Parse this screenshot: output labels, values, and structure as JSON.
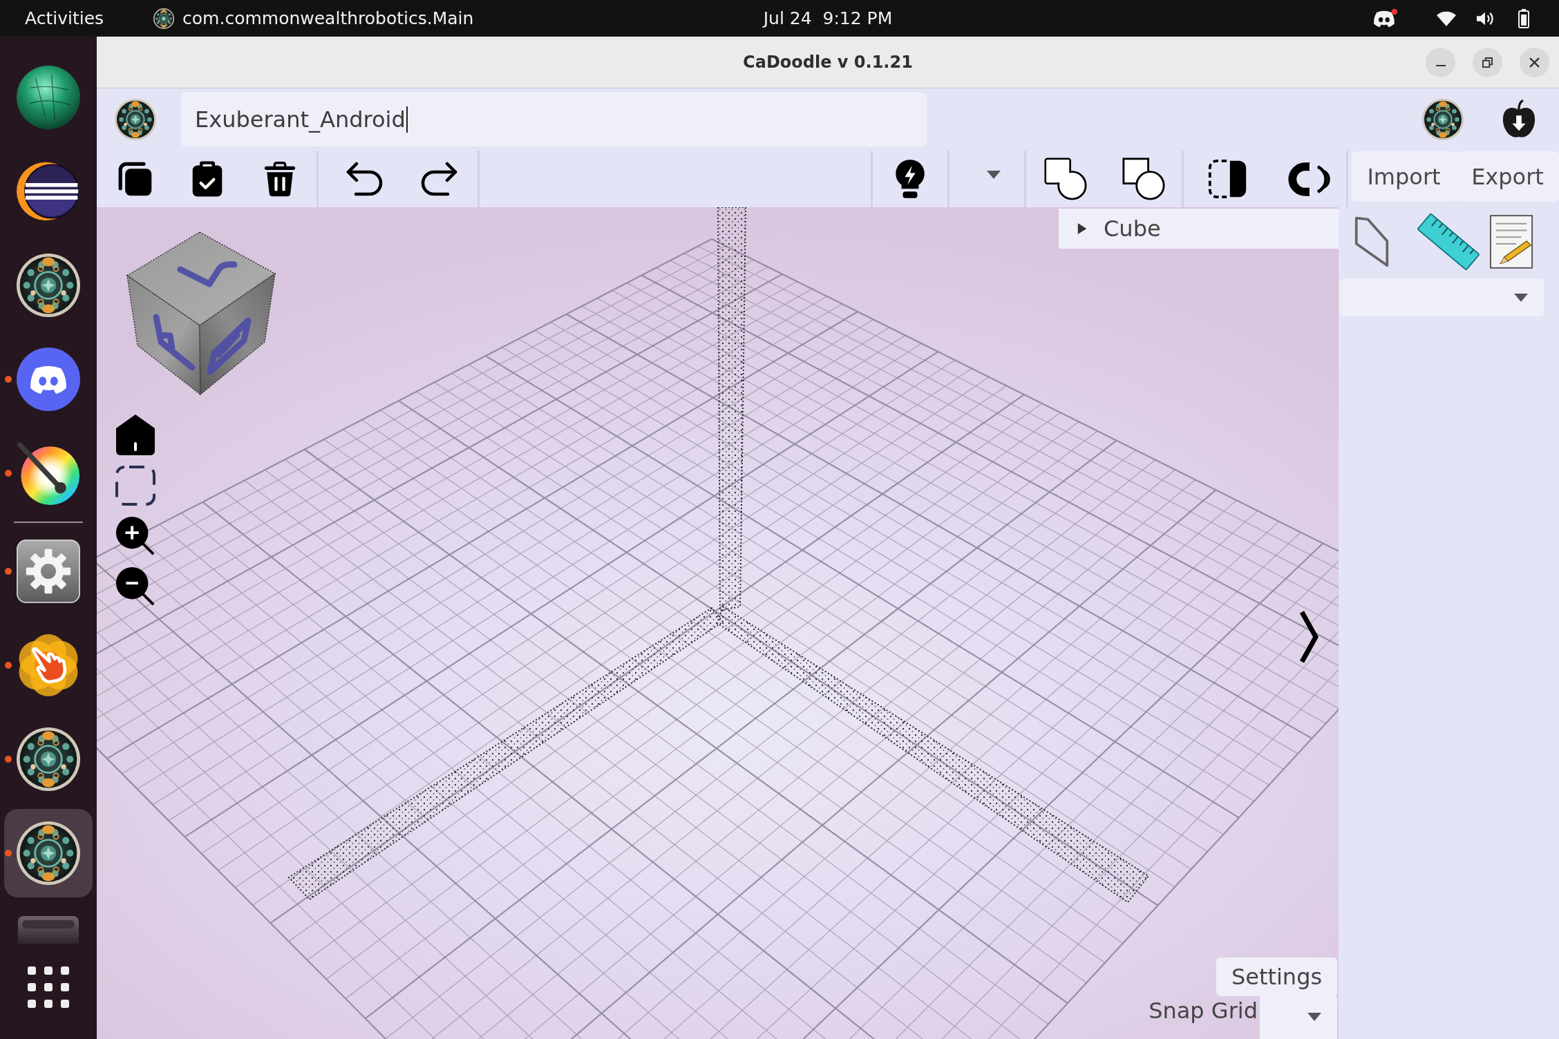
{
  "top_bar": {
    "activities": "Activities",
    "app_menu": "com.commonwealthrobotics.Main",
    "clock": "Jul 24  9:12 PM"
  },
  "dock": {
    "pinned": [
      {
        "running": false,
        "selected": false
      },
      {
        "running": false,
        "selected": false
      },
      {
        "running": false,
        "selected": false
      },
      {
        "running": true,
        "selected": false
      },
      {
        "running": true,
        "selected": false
      }
    ],
    "apps": [
      {
        "running": true,
        "selected": false
      },
      {
        "running": true,
        "selected": false
      },
      {
        "running": true,
        "selected": false
      },
      {
        "running": true,
        "selected": true
      }
    ]
  },
  "window": {
    "title": "CaDoodle v 0.1.21"
  },
  "project": {
    "name": "Exuberant_Android",
    "focused": true
  },
  "toolbar": {
    "buttons": [
      "Import",
      "Export"
    ]
  },
  "tree": [
    {
      "label": "Cube",
      "expanded": false
    }
  ],
  "viewport": {
    "settings": "Settings",
    "snap_grid": {
      "label": "Snap Grid"
    }
  }
}
